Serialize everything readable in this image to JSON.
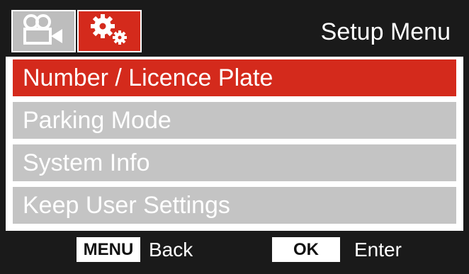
{
  "header": {
    "title": "Setup Menu",
    "tabs": [
      {
        "icon": "video-camera-icon",
        "state": "inactive"
      },
      {
        "icon": "gears-icon",
        "state": "active"
      }
    ]
  },
  "menu": {
    "items": [
      {
        "label": "Number / Licence Plate",
        "selected": true
      },
      {
        "label": "Parking Mode",
        "selected": false
      },
      {
        "label": "System Info",
        "selected": false
      },
      {
        "label": "Keep User Settings",
        "selected": false
      }
    ]
  },
  "footer": {
    "menu_key": "MENU",
    "menu_action": "Back",
    "ok_key": "OK",
    "ok_action": "Enter"
  },
  "colors": {
    "accent": "#d42a1c",
    "inactive": "#c4c4c4",
    "frame": "#1a1a1a"
  }
}
